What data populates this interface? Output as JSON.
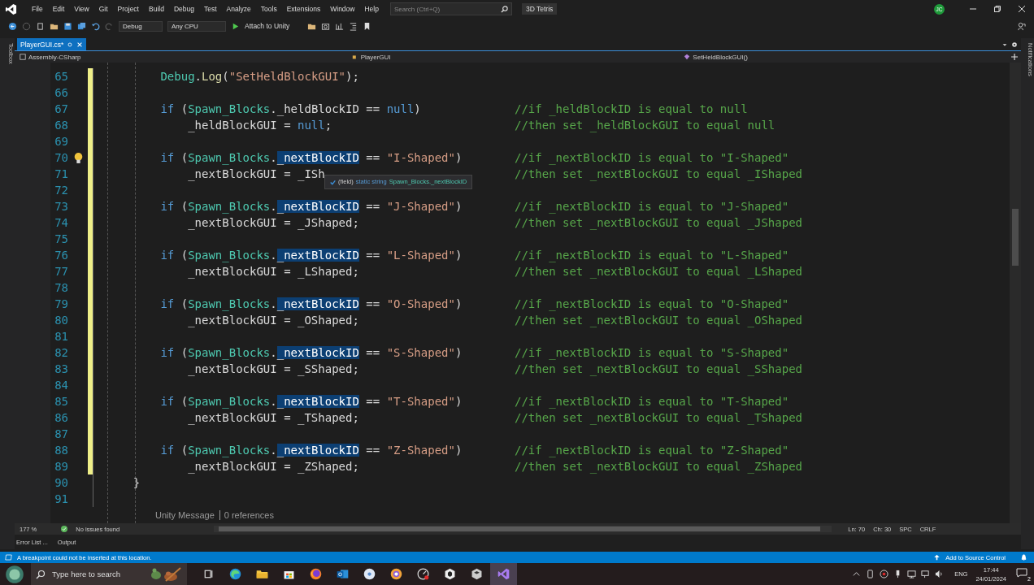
{
  "menu": [
    "File",
    "Edit",
    "View",
    "Git",
    "Project",
    "Build",
    "Debug",
    "Test",
    "Analyze",
    "Tools",
    "Extensions",
    "Window",
    "Help"
  ],
  "search": {
    "placeholder": "Search (Ctrl+Q)"
  },
  "solution_name": "3D Tetris",
  "avatar": "JC",
  "toolbar": {
    "configuration": "Debug",
    "platform": "Any CPU",
    "run_button": "Attach to Unity"
  },
  "left_strip": "Toolbox",
  "right_strip": "Notifications",
  "tabs": [
    {
      "label": "PlayerGUI.cs*",
      "selected": true
    }
  ],
  "nav_bar": {
    "project": "Assembly-CSharp",
    "class": "PlayerGUI",
    "member": "SetHeldBlockGUI()"
  },
  "lines": [
    {
      "number": "65",
      "changed": true,
      "lightbulb": false,
      "tokens": [
        {
          "text": "        Debug",
          "kind": "type"
        },
        {
          "text": ".",
          "kind": "plain"
        },
        {
          "text": "Log",
          "kind": "method"
        },
        {
          "text": "(",
          "kind": "plain"
        },
        {
          "text": "\"SetHeldBlockGUI\"",
          "kind": "string"
        },
        {
          "text": ");",
          "kind": "plain"
        }
      ]
    },
    {
      "number": "66",
      "changed": true,
      "lightbulb": false
    },
    {
      "number": "67",
      "changed": true,
      "lightbulb": false,
      "tokens": [
        {
          "text": "        if",
          "kind": "keyword"
        },
        {
          "text": " (",
          "kind": "plain"
        },
        {
          "text": "Spawn_Blocks",
          "kind": "type"
        },
        {
          "text": ".",
          "kind": "plain"
        },
        {
          "text": "_heldBlockID",
          "kind": "plain"
        },
        {
          "text": " == ",
          "kind": "plain"
        },
        {
          "text": "null",
          "kind": "keyword"
        },
        {
          "text": ")",
          "kind": "plain"
        }
      ],
      "comment": "//if _heldBlockID is equal to null"
    },
    {
      "number": "68",
      "changed": true,
      "lightbulb": false,
      "tokens": [
        {
          "text": "            _heldBlockGUI",
          "kind": "plain"
        },
        {
          "text": " = ",
          "kind": "plain"
        },
        {
          "text": "null",
          "kind": "keyword"
        },
        {
          "text": ";",
          "kind": "plain"
        }
      ],
      "comment": "//then set _heldBlockGUI to equal null"
    },
    {
      "number": "69",
      "changed": true,
      "lightbulb": false
    },
    {
      "number": "70",
      "changed": true,
      "lightbulb": true,
      "tokens": [
        {
          "text": "        if",
          "kind": "keyword"
        },
        {
          "text": " (",
          "kind": "plain"
        },
        {
          "text": "Spawn_Blocks",
          "kind": "type"
        },
        {
          "text": ".",
          "kind": "plain"
        },
        {
          "text": "_nextBlockID",
          "kind": "match"
        },
        {
          "text": " == ",
          "kind": "plain"
        },
        {
          "text": "\"I-Shaped\"",
          "kind": "string"
        },
        {
          "text": ")",
          "kind": "plain"
        }
      ],
      "comment": "//if _nextBlockID is equal to \"I-Shaped\""
    },
    {
      "number": "71",
      "changed": true,
      "lightbulb": false,
      "tokens": [
        {
          "text": "            _nextBlockGUI",
          "kind": "plain"
        },
        {
          "text": " = ",
          "kind": "plain"
        },
        {
          "text": "_ISh",
          "kind": "plain"
        }
      ],
      "comment": "//then set _nextBlockGUI to equal _IShaped",
      "tooltip": {
        "kind": "(field)",
        "signature": "static string",
        "symbol": "Spawn_Blocks._nextBlockID"
      }
    },
    {
      "number": "72",
      "changed": true,
      "lightbulb": false
    },
    {
      "number": "73",
      "changed": true,
      "lightbulb": false,
      "tokens": [
        {
          "text": "        if",
          "kind": "keyword"
        },
        {
          "text": " (",
          "kind": "plain"
        },
        {
          "text": "Spawn_Blocks",
          "kind": "type"
        },
        {
          "text": ".",
          "kind": "plain"
        },
        {
          "text": "_nextBlockID",
          "kind": "match"
        },
        {
          "text": " == ",
          "kind": "plain"
        },
        {
          "text": "\"J-Shaped\"",
          "kind": "string"
        },
        {
          "text": ")",
          "kind": "plain"
        }
      ],
      "comment": "//if _nextBlockID is equal to \"J-Shaped\""
    },
    {
      "number": "74",
      "changed": true,
      "lightbulb": false,
      "tokens": [
        {
          "text": "            _nextBlockGUI",
          "kind": "plain"
        },
        {
          "text": " = ",
          "kind": "plain"
        },
        {
          "text": "_JShaped",
          "kind": "plain"
        },
        {
          "text": ";",
          "kind": "plain"
        }
      ],
      "comment": "//then set _nextBlockGUI to equal _JShaped"
    },
    {
      "number": "75",
      "changed": true,
      "lightbulb": false
    },
    {
      "number": "76",
      "changed": true,
      "lightbulb": false,
      "tokens": [
        {
          "text": "        if",
          "kind": "keyword"
        },
        {
          "text": " (",
          "kind": "plain"
        },
        {
          "text": "Spawn_Blocks",
          "kind": "type"
        },
        {
          "text": ".",
          "kind": "plain"
        },
        {
          "text": "_nextBlockID",
          "kind": "match"
        },
        {
          "text": " == ",
          "kind": "plain"
        },
        {
          "text": "\"L-Shaped\"",
          "kind": "string"
        },
        {
          "text": ")",
          "kind": "plain"
        }
      ],
      "comment": "//if _nextBlockID is equal to \"L-Shaped\""
    },
    {
      "number": "77",
      "changed": true,
      "lightbulb": false,
      "tokens": [
        {
          "text": "            _nextBlockGUI",
          "kind": "plain"
        },
        {
          "text": " = ",
          "kind": "plain"
        },
        {
          "text": "_LShaped",
          "kind": "plain"
        },
        {
          "text": ";",
          "kind": "plain"
        }
      ],
      "comment": "//then set _nextBlockGUI to equal _LShaped"
    },
    {
      "number": "78",
      "changed": true,
      "lightbulb": false
    },
    {
      "number": "79",
      "changed": true,
      "lightbulb": false,
      "tokens": [
        {
          "text": "        if",
          "kind": "keyword"
        },
        {
          "text": " (",
          "kind": "plain"
        },
        {
          "text": "Spawn_Blocks",
          "kind": "type"
        },
        {
          "text": ".",
          "kind": "plain"
        },
        {
          "text": "_nextBlockID",
          "kind": "match"
        },
        {
          "text": " == ",
          "kind": "plain"
        },
        {
          "text": "\"O-Shaped\"",
          "kind": "string"
        },
        {
          "text": ")",
          "kind": "plain"
        }
      ],
      "comment": "//if _nextBlockID is equal to \"O-Shaped\""
    },
    {
      "number": "80",
      "changed": true,
      "lightbulb": false,
      "tokens": [
        {
          "text": "            _nextBlockGUI",
          "kind": "plain"
        },
        {
          "text": " = ",
          "kind": "plain"
        },
        {
          "text": "_OShaped",
          "kind": "plain"
        },
        {
          "text": ";",
          "kind": "plain"
        }
      ],
      "comment": "//then set _nextBlockGUI to equal _OShaped"
    },
    {
      "number": "81",
      "changed": true,
      "lightbulb": false
    },
    {
      "number": "82",
      "changed": true,
      "lightbulb": false,
      "tokens": [
        {
          "text": "        if",
          "kind": "keyword"
        },
        {
          "text": " (",
          "kind": "plain"
        },
        {
          "text": "Spawn_Blocks",
          "kind": "type"
        },
        {
          "text": ".",
          "kind": "plain"
        },
        {
          "text": "_nextBlockID",
          "kind": "match"
        },
        {
          "text": " == ",
          "kind": "plain"
        },
        {
          "text": "\"S-Shaped\"",
          "kind": "string"
        },
        {
          "text": ")",
          "kind": "plain"
        }
      ],
      "comment": "//if _nextBlockID is equal to \"S-Shaped\""
    },
    {
      "number": "83",
      "changed": true,
      "lightbulb": false,
      "tokens": [
        {
          "text": "            _nextBlockGUI",
          "kind": "plain"
        },
        {
          "text": " = ",
          "kind": "plain"
        },
        {
          "text": "_SShaped",
          "kind": "plain"
        },
        {
          "text": ";",
          "kind": "plain"
        }
      ],
      "comment": "//then set _nextBlockGUI to equal _SShaped"
    },
    {
      "number": "84",
      "changed": true,
      "lightbulb": false
    },
    {
      "number": "85",
      "changed": true,
      "lightbulb": false,
      "tokens": [
        {
          "text": "        if",
          "kind": "keyword"
        },
        {
          "text": " (",
          "kind": "plain"
        },
        {
          "text": "Spawn_Blocks",
          "kind": "type"
        },
        {
          "text": ".",
          "kind": "plain"
        },
        {
          "text": "_nextBlockID",
          "kind": "match"
        },
        {
          "text": " == ",
          "kind": "plain"
        },
        {
          "text": "\"T-Shaped\"",
          "kind": "string"
        },
        {
          "text": ")",
          "kind": "plain"
        }
      ],
      "comment": "//if _nextBlockID is equal to \"T-Shaped\""
    },
    {
      "number": "86",
      "changed": true,
      "lightbulb": false,
      "tokens": [
        {
          "text": "            _nextBlockGUI",
          "kind": "plain"
        },
        {
          "text": " = ",
          "kind": "plain"
        },
        {
          "text": "_TShaped",
          "kind": "plain"
        },
        {
          "text": ";",
          "kind": "plain"
        }
      ],
      "comment": "//then set _nextBlockGUI to equal _TShaped"
    },
    {
      "number": "87",
      "changed": true,
      "lightbulb": false
    },
    {
      "number": "88",
      "changed": true,
      "lightbulb": false,
      "tokens": [
        {
          "text": "        if",
          "kind": "keyword"
        },
        {
          "text": " (",
          "kind": "plain"
        },
        {
          "text": "Spawn_Blocks",
          "kind": "type"
        },
        {
          "text": ".",
          "kind": "plain"
        },
        {
          "text": "_nextBlockID",
          "kind": "match"
        },
        {
          "text": " == ",
          "kind": "plain"
        },
        {
          "text": "\"Z-Shaped\"",
          "kind": "string"
        },
        {
          "text": ")",
          "kind": "plain"
        }
      ],
      "comment": "//if _nextBlockID is equal to \"Z-Shaped\""
    },
    {
      "number": "89",
      "changed": true,
      "lightbulb": false,
      "tokens": [
        {
          "text": "            _nextBlockGUI",
          "kind": "plain"
        },
        {
          "text": " = ",
          "kind": "plain"
        },
        {
          "text": "_ZShaped",
          "kind": "plain"
        },
        {
          "text": ";",
          "kind": "plain"
        }
      ],
      "comment": "//then set _nextBlockGUI to equal _ZShaped"
    },
    {
      "number": "90",
      "changed": false,
      "lightbulb": false,
      "tokens": [
        {
          "text": "    }",
          "kind": "plain"
        }
      ]
    },
    {
      "number": "91",
      "changed": false,
      "lightbulb": false
    }
  ],
  "codelens": {
    "kind": "Unity Message",
    "references": "0 references"
  },
  "editor_status": {
    "zoom": "177 %",
    "issues": "No issues found",
    "line": "Ln: 70",
    "column": "Ch: 30",
    "indent": "SPC",
    "line_ending": "CRLF"
  },
  "panel_tabs": [
    "Error List ...",
    "Output"
  ],
  "status_bar": {
    "message": "A breakpoint could not be inserted at this location.",
    "source_control": "Add to Source Control"
  },
  "taskbar": {
    "search_placeholder": "Type here to search",
    "language": "ENG",
    "time": "17:44",
    "date": "24/01/2024",
    "notifications": "2"
  }
}
